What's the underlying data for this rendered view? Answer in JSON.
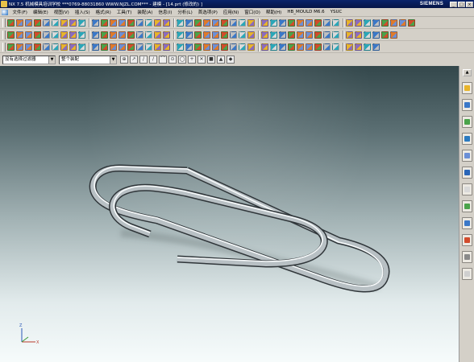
{
  "window": {
    "title": "NX 7.5 机械模具培训学校 ***0769-88031860 WWW.NJZL.COM*** - 建模 - [14.prt (修改的) ]",
    "brand": "SIEMENS",
    "controls": [
      "_",
      "□",
      "×"
    ]
  },
  "menu": {
    "items": [
      "文件(F)",
      "编辑(E)",
      "视图(V)",
      "插入(S)",
      "格式(R)",
      "工具(T)",
      "装配(A)",
      "信息(I)",
      "分析(L)",
      "首选项(P)",
      "应用(N)",
      "窗口(O)",
      "帮助(H)",
      "HB_MOULD M6.6",
      "YSUC"
    ]
  },
  "toolbars": {
    "row1_count": 44,
    "row2_count": 42,
    "row3_count": 40,
    "icon_colors": [
      "#3a78c8",
      "#e8b42a",
      "#d24b2b",
      "#4aa34a",
      "#8a6bbf",
      "#c0c0c0",
      "#e07a2a",
      "#2aa7b8",
      "#d9d9d9",
      "#6b8fd6"
    ]
  },
  "selection": {
    "filter_value": "没有选择过滤器",
    "scope_value": "整个装配",
    "snap_icons": [
      "⊕",
      "↗",
      "/",
      "∕",
      "⌒",
      "⊙",
      "◯",
      "+",
      "✕",
      "■",
      "▲",
      "◆"
    ]
  },
  "resource_bar": {
    "tabs": [
      "assembly-navigator",
      "constraint-navigator",
      "part-navigator",
      "reuse-library",
      "web-browser",
      "history",
      "system-materials",
      "process-studio",
      "manufacturing-wizards",
      "roles",
      "system-scenes",
      "help"
    ],
    "tab_colors": [
      "#e8b42a",
      "#3a78c8",
      "#4aa34a",
      "#2a7ac0",
      "#6b8fd6",
      "#2a66b8",
      "#d9d9d9",
      "#4aa34a",
      "#3a78c8",
      "#d24b2b",
      "#8a8a8a",
      "#cfcfcf"
    ]
  },
  "viewport": {
    "model": "paperclip",
    "background_top": "#33474b",
    "background_bottom": "#f6fbfb",
    "triad_labels": [
      "Z",
      "X"
    ]
  }
}
